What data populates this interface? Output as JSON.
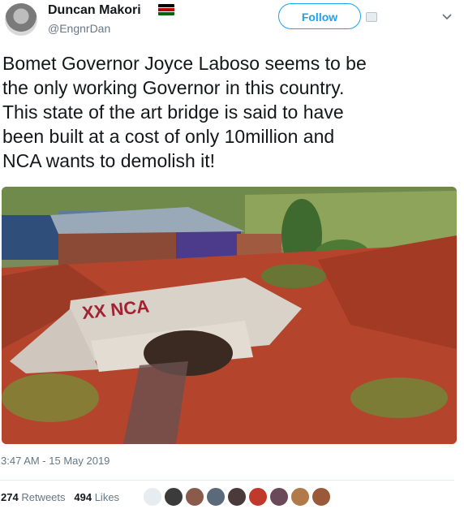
{
  "tweet": {
    "author_name": "Duncan Makori",
    "author_handle": "@EngnrDan",
    "follow_label": "Follow",
    "text": "Bomet Governor Joyce Laboso seems to be\nthe only working Governor in this country.\nThis state of the art bridge is said to have\nbeen built at a cost of only 10million and\nNCA wants to demolish it!",
    "timestamp": "3:47 AM - 15 May 2019",
    "retweet_count": "274",
    "retweet_label": "Retweets",
    "like_count": "494",
    "like_label": "Likes"
  },
  "photo": {
    "painted_text": "XX NCA"
  },
  "colors": {
    "accent": "#1da1f2",
    "secondary_text": "#657786",
    "primary_text": "#14171a"
  }
}
